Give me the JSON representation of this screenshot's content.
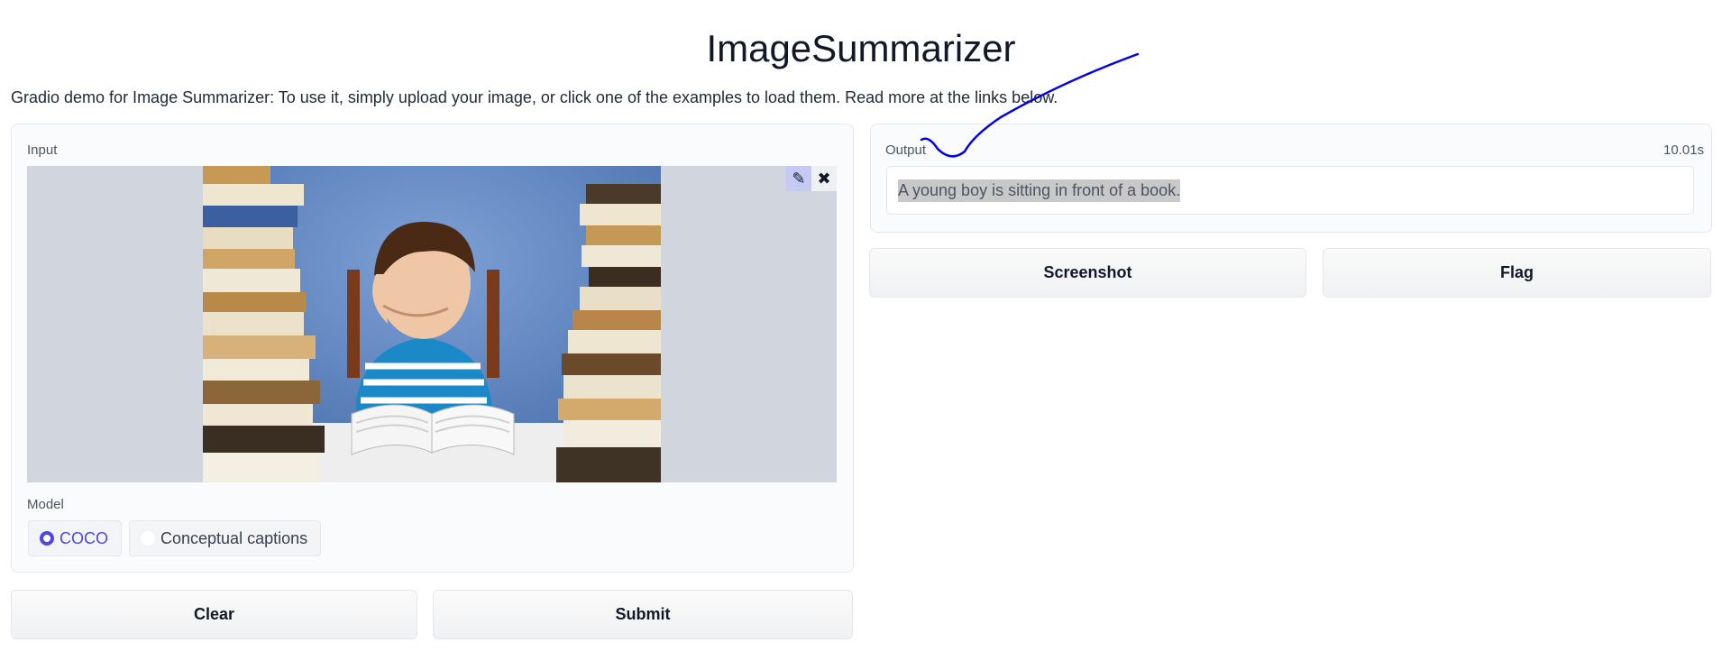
{
  "app": {
    "title": "ImageSummarizer",
    "description": "Gradio demo for Image Summarizer: To use it, simply upload your image, or click one of the examples to load them. Read more at the links below."
  },
  "input": {
    "label": "Input",
    "image_tools": [
      {
        "icon": "pencil-icon",
        "glyph": "✎"
      },
      {
        "icon": "close-icon",
        "glyph": "✖"
      }
    ],
    "model": {
      "label": "Model",
      "options": [
        "COCO",
        "Conceptual captions"
      ],
      "selected": "COCO"
    },
    "clear_label": "Clear",
    "submit_label": "Submit"
  },
  "output": {
    "label": "Output",
    "timer": "10.01s",
    "text": "A young boy is sitting in front of a book.",
    "screenshot_label": "Screenshot",
    "flag_label": "Flag"
  },
  "colors": {
    "accent": "#4f46e5",
    "annotation_stroke": "#0000ee"
  }
}
